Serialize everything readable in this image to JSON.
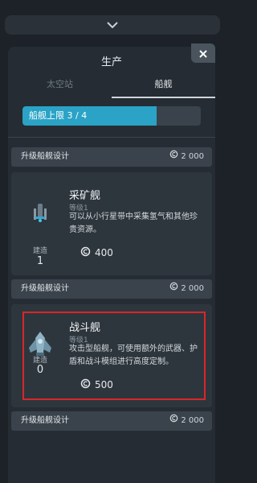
{
  "panel": {
    "title": "生产",
    "tabs": [
      {
        "label": "太空站",
        "active": false
      },
      {
        "label": "船舰",
        "active": true
      }
    ],
    "capacity": {
      "label": "船舰上限 3 / 4",
      "used": 3,
      "max": 4,
      "fill_fraction": 0.75
    }
  },
  "upgrade_rows": [
    {
      "label": "升级船舰设计",
      "cost": "2 000"
    },
    {
      "label": "升级船舰设计",
      "cost": "2 000"
    },
    {
      "label": "升级船舰设计",
      "cost": "2 000"
    }
  ],
  "ships": [
    {
      "name": "采矿舰",
      "level": "等级1",
      "description": "可以从小行星带中采集氢气和其他珍贵资源。",
      "cost": "400",
      "build_label": "建造",
      "build_count": "1"
    },
    {
      "name": "战斗舰",
      "level": "等级1",
      "description": "攻击型船舰，可使用额外的武器、护盾和战斗模组进行高度定制。",
      "cost": "500",
      "build_label": "建造",
      "build_count": "0"
    }
  ],
  "icons": {
    "expand": "chevron-down-icon",
    "close": "close-icon",
    "credits": "credits-icon",
    "miner": "mining-ship-icon",
    "fighter": "battleship-icon"
  },
  "colors": {
    "accent": "#2aa3c6",
    "highlight": "#d9262b",
    "panel": "#252c33"
  }
}
